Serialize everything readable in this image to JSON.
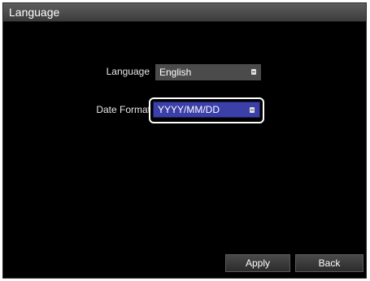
{
  "window": {
    "title": "Language"
  },
  "form": {
    "language": {
      "label": "Language",
      "value": "English"
    },
    "date_format": {
      "label": "Date Format",
      "value": "YYYY/MM/DD"
    }
  },
  "buttons": {
    "apply": "Apply",
    "back": "Back"
  },
  "colors": {
    "focused_field": "#3b3fa8",
    "background": "#000000"
  }
}
